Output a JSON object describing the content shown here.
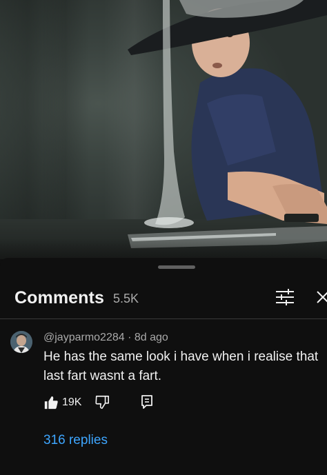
{
  "comments_panel": {
    "title": "Comments",
    "count": "5.5K"
  },
  "comment": {
    "author": "@jayparmo2284",
    "separator": "·",
    "age": "8d ago",
    "text": "He has the same look i have when i realise that last fart wasnt a fart.",
    "likes": "19K",
    "replies_label": "316 replies"
  },
  "icons": {
    "filter": "sliders-icon",
    "close": "close-icon",
    "like": "thumbs-up-icon",
    "dislike": "thumbs-down-icon",
    "reply": "reply-icon"
  },
  "colors": {
    "background": "#0f0f0f",
    "text_primary": "#f1f1f1",
    "text_secondary": "#aaaaaa",
    "link": "#3ea6ff",
    "divider": "#3a3a3a"
  }
}
